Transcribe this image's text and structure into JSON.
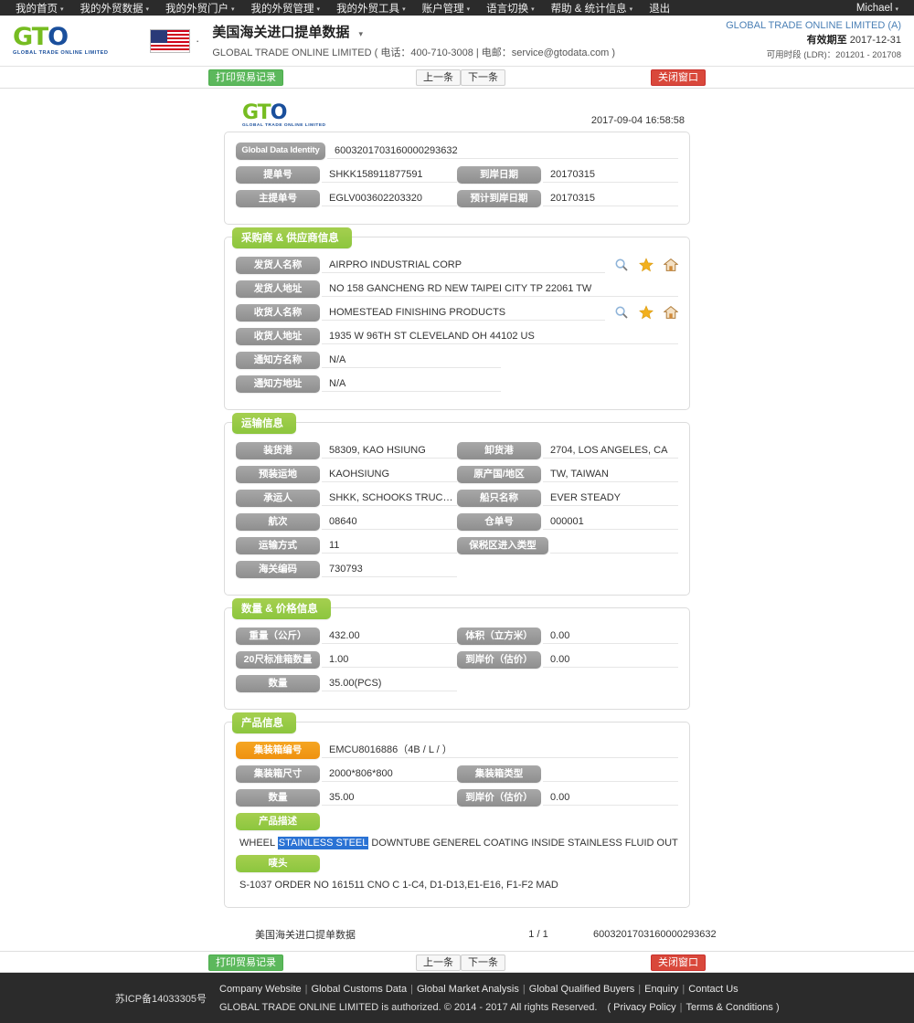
{
  "topnav": {
    "items": [
      {
        "label": "我的首页",
        "caret": true
      },
      {
        "label": "我的外贸数据",
        "caret": true
      },
      {
        "label": "我的外贸门户",
        "caret": true
      },
      {
        "label": "我的外贸管理",
        "caret": true
      },
      {
        "label": "我的外贸工具",
        "caret": true
      },
      {
        "label": "账户管理",
        "caret": true
      },
      {
        "label": "语言切换",
        "caret": true
      },
      {
        "label": "帮助 & 统计信息",
        "caret": true
      },
      {
        "label": "退出",
        "caret": false
      }
    ],
    "user": "Michael"
  },
  "header": {
    "logo_g": "G",
    "logo_t": "T",
    "logo_o": "O",
    "logo_sub": "GLOBAL TRADE ONLINE LIMITED",
    "flag_icon": "us-flag-icon",
    "title": "美国海关进口提单数据",
    "subtitle": "GLOBAL TRADE ONLINE LIMITED ( 电话：400-710-3008 | 电邮：service@gtodata.com )",
    "company": "GLOBAL TRADE ONLINE LIMITED (A)",
    "valid_label": "有效期至",
    "valid_value": "2017-12-31",
    "ldr_label": "可用时段 (LDR)：",
    "ldr_value": "201201 - 201708"
  },
  "toolbar": {
    "print_label": "打印贸易记录",
    "prev_label": "上一条",
    "next_label": "下一条",
    "close_label": "关闭窗口"
  },
  "sheet": {
    "timestamp": "2017-09-04 16:58:58",
    "identity": {
      "label": "Global Data Identity",
      "value": "6003201703160000293632"
    },
    "bill_no": {
      "label": "提单号",
      "value": "SHKK158911877591"
    },
    "arrival_date": {
      "label": "到岸日期",
      "value": "20170315"
    },
    "master_bill_no": {
      "label": "主提单号",
      "value": "EGLV003602203320"
    },
    "est_arrival_date": {
      "label": "预计到岸日期",
      "value": "20170315"
    },
    "parties": {
      "title": "采购商 & 供应商信息",
      "shipper_name": {
        "label": "发货人名称",
        "value": "AIRPRO INDUSTRIAL CORP"
      },
      "shipper_addr": {
        "label": "发货人地址",
        "value": "NO 158 GANCHENG RD NEW TAIPEI CITY TP 22061 TW"
      },
      "consignee_name": {
        "label": "收货人名称",
        "value": "HOMESTEAD FINISHING PRODUCTS"
      },
      "consignee_addr": {
        "label": "收货人地址",
        "value": "1935 W 96TH ST CLEVELAND OH 44102 US"
      },
      "notify_name": {
        "label": "通知方名称",
        "value": "N/A"
      },
      "notify_addr": {
        "label": "通知方地址",
        "value": "N/A"
      },
      "icons": [
        "search-icon",
        "star-icon",
        "home-icon"
      ]
    },
    "transport": {
      "title": "运输信息",
      "load_port": {
        "label": "装货港",
        "value": "58309, KAO HSIUNG"
      },
      "discharge_port": {
        "label": "卸货港",
        "value": "2704, LOS ANGELES, CA"
      },
      "pre_load_place": {
        "label": "预装运地",
        "value": "KAOHSIUNG"
      },
      "origin_country": {
        "label": "原产国/地区",
        "value": "TW, TAIWAN"
      },
      "carrier": {
        "label": "承运人",
        "value": "SHKK, SCHOOKS TRUCKING"
      },
      "vessel_name": {
        "label": "船只名称",
        "value": "EVER STEADY"
      },
      "voyage": {
        "label": "航次",
        "value": "08640"
      },
      "warehouse_no": {
        "label": "仓单号",
        "value": "000001"
      },
      "transport_mode": {
        "label": "运输方式",
        "value": "11"
      },
      "bonded_entry_type": {
        "label": "保税区进入类型",
        "value": ""
      },
      "hs_code": {
        "label": "海关编码",
        "value": "730793"
      }
    },
    "quantity": {
      "title": "数量 & 价格信息",
      "weight": {
        "label": "重量（公斤）",
        "value": "432.00"
      },
      "volume": {
        "label": "体积（立方米）",
        "value": "0.00"
      },
      "teu": {
        "label": "20尺标准箱数量",
        "value": "1.00"
      },
      "cif": {
        "label": "到岸价（估价）",
        "value": "0.00"
      },
      "qty": {
        "label": "数量",
        "value": "35.00(PCS)"
      }
    },
    "product": {
      "title": "产品信息",
      "container_no": {
        "label": "集装箱编号",
        "value": "EMCU8016886（4B / L / ）"
      },
      "container_size": {
        "label": "集装箱尺寸",
        "value": "2000*806*800"
      },
      "container_type": {
        "label": "集装箱类型",
        "value": ""
      },
      "qty": {
        "label": "数量",
        "value": "35.00"
      },
      "cif": {
        "label": "到岸价（估价）",
        "value": "0.00"
      },
      "desc_label": "产品描述",
      "desc_pre": "WHEEL ",
      "desc_highlight": "STAINLESS STEEL",
      "desc_post": " DOWNTUBE GENEREL COATING INSIDE STAINLESS FLUID OUTLETS NEEDLE PACKI",
      "marks_label": "唛头",
      "marks_value": "S-1037 ORDER NO 161511 CNO C 1-C4, D1-D13,E1-E16, F1-F2 MAD"
    },
    "footer": {
      "name": "美国海关进口提单数据",
      "page": "1 / 1",
      "identity": "6003201703160000293632"
    }
  },
  "footer": {
    "icp": "苏ICP备14033305号",
    "links": [
      "Company Website",
      "Global Customs Data",
      "Global Market Analysis",
      "Global Qualified Buyers",
      "Enquiry",
      "Contact Us"
    ],
    "copyright": "GLOBAL TRADE ONLINE LIMITED is authorized. © 2014 - 2017 All rights Reserved.　(",
    "privacy": "Privacy Policy",
    "terms": "Terms & Conditions",
    "close_paren": ")"
  },
  "colors": {
    "green": "#8cc63e",
    "orange": "#ef9110",
    "red": "#d9483b",
    "nav_bg": "#2b2b2b",
    "chip_gray": "#8e8e8e",
    "highlight": "#2a72d4"
  }
}
